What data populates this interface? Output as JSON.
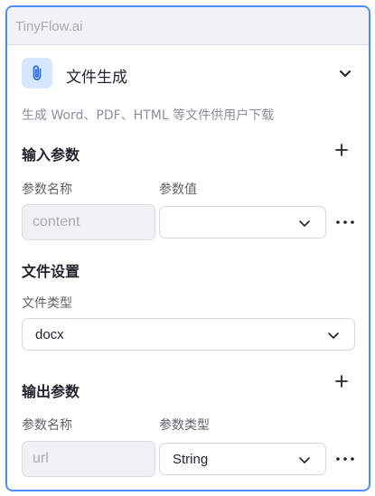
{
  "header": {
    "brand": "TinyFlow.ai"
  },
  "node": {
    "title": "文件生成",
    "description": "生成 Word、PDF、HTML 等文件供用户下载"
  },
  "input_params": {
    "section_title": "输入参数",
    "col_name": "参数名称",
    "col_value": "参数值",
    "rows": [
      {
        "name": "content",
        "value": ""
      }
    ]
  },
  "file_settings": {
    "section_title": "文件设置",
    "type_label": "文件类型",
    "type_value": "docx"
  },
  "output_params": {
    "section_title": "输出参数",
    "col_name": "参数名称",
    "col_type": "参数类型",
    "rows": [
      {
        "name": "url",
        "type": "String"
      }
    ]
  },
  "colors": {
    "accent": "#4c8df6",
    "icon_bg": "#d9e6ff"
  }
}
